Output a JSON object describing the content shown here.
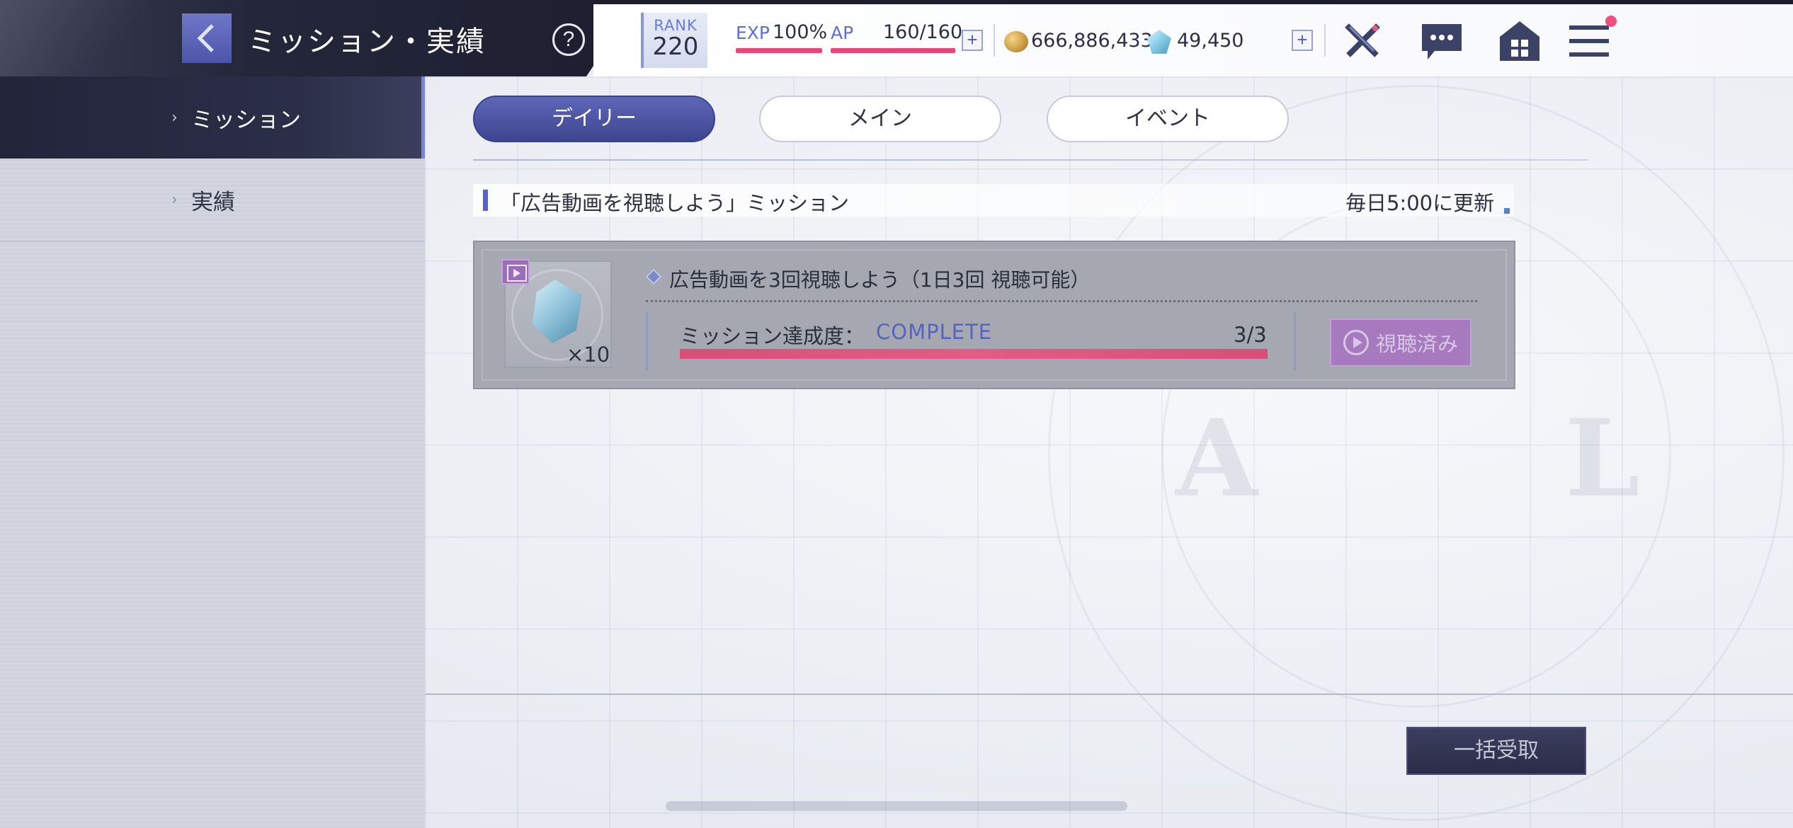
{
  "header": {
    "title": "ミッション・実績",
    "help_symbol": "?",
    "rank_label": "RANK",
    "rank_value": "220",
    "exp_label": "EXP",
    "exp_value": "100%",
    "exp_fill": 1.0,
    "ap_label": "AP",
    "ap_value": "160/160",
    "ap_fill": 1.0,
    "add_symbol": "+",
    "coins": "666,886,433",
    "gems": "49,450",
    "icons": [
      "back-arrow-icon",
      "help-icon",
      "coin-icon",
      "gem-icon",
      "crossed-swords-icon",
      "chat-icon",
      "home-icon",
      "menu-icon"
    ],
    "menu_has_notification": true
  },
  "sidebar": {
    "items": [
      {
        "label": "ミッション",
        "active": true
      },
      {
        "label": "実績",
        "active": false
      }
    ]
  },
  "tabs": [
    {
      "label": "デイリー",
      "active": true
    },
    {
      "label": "メイン",
      "active": false
    },
    {
      "label": "イベント",
      "active": false
    }
  ],
  "section": {
    "title": "「広告動画を視聴しよう」ミッション",
    "refresh": "毎日5:00に更新"
  },
  "mission": {
    "name": "広告動画を3回視聴しよう（1日3回 視聴可能）",
    "reward_qty": "×10",
    "progress_label": "ミッション達成度：",
    "progress_status": "COMPLETE",
    "progress_count": "3/3",
    "progress_fill": 1.0,
    "button_label": "視聴済み"
  },
  "footer": {
    "claim_all_label": "一括受取"
  },
  "colors": {
    "accent": "#5e66b8",
    "progress": "#e85a86",
    "watched_button": "#a779be"
  }
}
